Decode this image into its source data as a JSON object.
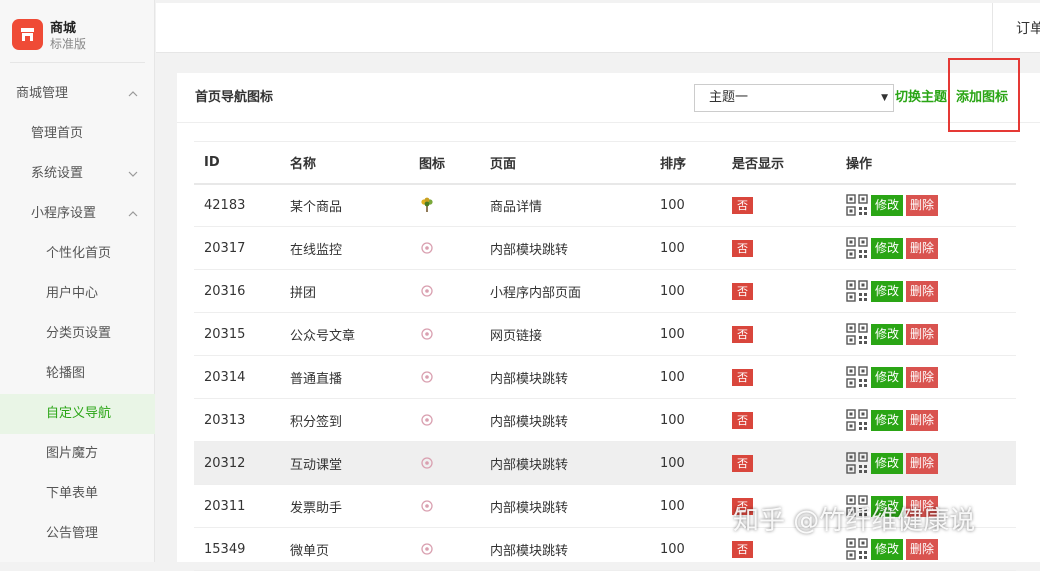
{
  "brand": {
    "title": "商城",
    "subtitle": "标准版",
    "accent": "#ef4b36"
  },
  "sidebar": {
    "items": [
      {
        "label": "商城管理",
        "expandable": true,
        "expanded": true
      },
      {
        "label": "管理首页"
      },
      {
        "label": "系统设置",
        "expandable": true,
        "expanded": false
      },
      {
        "label": "小程序设置",
        "expandable": true,
        "expanded": true
      },
      {
        "label": "个性化首页"
      },
      {
        "label": "用户中心"
      },
      {
        "label": "分类页设置"
      },
      {
        "label": "轮播图"
      },
      {
        "label": "自定义导航",
        "active": true
      },
      {
        "label": "图片魔方"
      },
      {
        "label": "下单表单"
      },
      {
        "label": "公告管理"
      }
    ]
  },
  "topbar": {
    "order_label": "订单"
  },
  "panel": {
    "title": "首页导航图标",
    "theme_select": "主题一",
    "switch_theme_label": "切换主题",
    "add_icon_label": "添加图标"
  },
  "table": {
    "headers": [
      "ID",
      "名称",
      "图标",
      "页面",
      "排序",
      "是否显示",
      "操作"
    ],
    "rows": [
      {
        "id": "42183",
        "name": "某个商品",
        "icon": "plant-icon",
        "page": "商品详情",
        "sort": "100",
        "show": "否"
      },
      {
        "id": "20317",
        "name": "在线监控",
        "icon": "monitor-icon",
        "page": "内部模块跳转",
        "sort": "100",
        "show": "否"
      },
      {
        "id": "20316",
        "name": "拼团",
        "icon": "group-icon",
        "page": "小程序内部页面",
        "sort": "100",
        "show": "否"
      },
      {
        "id": "20315",
        "name": "公众号文章",
        "icon": "article-icon",
        "page": "网页链接",
        "sort": "100",
        "show": "否"
      },
      {
        "id": "20314",
        "name": "普通直播",
        "icon": "live-icon",
        "page": "内部模块跳转",
        "sort": "100",
        "show": "否"
      },
      {
        "id": "20313",
        "name": "积分签到",
        "icon": "points-icon",
        "page": "内部模块跳转",
        "sort": "100",
        "show": "否"
      },
      {
        "id": "20312",
        "name": "互动课堂",
        "icon": "class-icon",
        "page": "内部模块跳转",
        "sort": "100",
        "show": "否"
      },
      {
        "id": "20311",
        "name": "发票助手",
        "icon": "invoice-icon",
        "page": "内部模块跳转",
        "sort": "100",
        "show": "否"
      },
      {
        "id": "15349",
        "name": "微单页",
        "icon": "page-icon",
        "page": "内部模块跳转",
        "sort": "100",
        "show": "否"
      }
    ],
    "edit_label": "修改",
    "delete_label": "删除"
  },
  "watermark": "知乎 @竹纤维健康说",
  "colors": {
    "green": "#2aa515",
    "red": "#d9463c",
    "highlight_border": "#e53935"
  }
}
